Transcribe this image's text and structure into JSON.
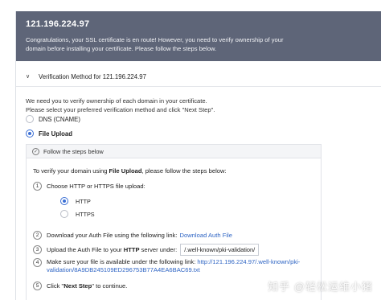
{
  "header": {
    "ip": "121.196.224.97",
    "message": "Congratulations, your SSL certificate is en route! However, you need to verify ownership of your domain before installing your certificate. Please follow the steps below."
  },
  "section": {
    "title": "Verification Method for 121.196.224.97"
  },
  "intro": {
    "line1": "We need you to verify ownership of each domain in your certificate.",
    "line2": "Please select your preferred verification method and click \"Next Step\"."
  },
  "methods": [
    {
      "label": "DNS (CNAME)",
      "selected": false
    },
    {
      "label": "File Upload",
      "selected": true
    }
  ],
  "steps_panel": {
    "header": "Follow the steps below",
    "intro_prefix": "To verify your domain using ",
    "intro_bold": "File Upload",
    "intro_suffix": ", please follow the steps below:",
    "step1": {
      "num": "1",
      "text": "Choose HTTP or HTTPS file upload:"
    },
    "protocols": [
      {
        "label": "HTTP",
        "selected": true
      },
      {
        "label": "HTTPS",
        "selected": false
      }
    ],
    "step2": {
      "num": "2",
      "text": "Download your Auth File using the following link: ",
      "link": "Download Auth File"
    },
    "step3": {
      "num": "3",
      "prefix": "Upload the Auth File to your ",
      "bold": "HTTP",
      "suffix": " server under:",
      "path": "/.well-known/pki-validation/"
    },
    "step4": {
      "num": "4",
      "text": "Make sure your file is available under the following link: ",
      "link_a": "http://121.196.224.97/.well-known/pki-",
      "link_b": "validation/8A9DB245109ED296753B77A4EA6BAC69.txt"
    },
    "step5": {
      "num": "5",
      "prefix": "Click \"",
      "bold": "Next Step",
      "suffix": "\" to continue."
    }
  },
  "watermark": "知乎 @轻松运维小猪"
}
